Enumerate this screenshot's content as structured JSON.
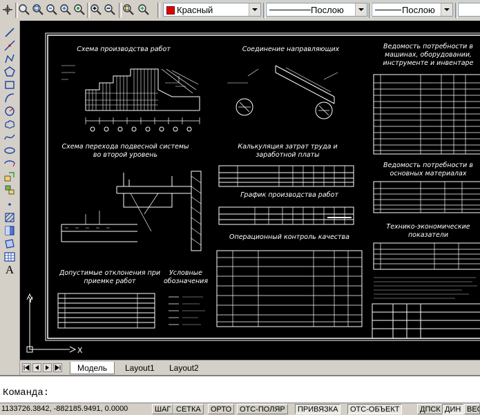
{
  "toolbar": {
    "zoom_buttons": [
      "pan-realtime-icon",
      "zoom-realtime-icon",
      "zoom-window-icon",
      "zoom-previous-icon",
      "zoom-extents-icon",
      "zoom-in-icon",
      "zoom-out-icon",
      "zoom-all-icon",
      "zoom-in-2-icon"
    ],
    "color_select": "Красный",
    "linetype_select": "Послою",
    "lineweight_select": "Послою",
    "accent_color": "#e00000"
  },
  "draw_toolbar": [
    "line-icon",
    "construction-line-icon",
    "polyline-icon",
    "polygon-icon",
    "rectangle-icon",
    "arc-icon",
    "circle-icon",
    "revcloud-icon",
    "spline-icon",
    "ellipse-icon",
    "ellipse-arc-icon",
    "insert-block-icon",
    "make-block-icon",
    "point-icon",
    "hatch-icon",
    "gradient-icon",
    "region-icon",
    "table-icon",
    "text-icon"
  ],
  "draw_text_glyph": "A",
  "drawing": {
    "titles": {
      "schema_works": "Схема производства работ",
      "guides": "Соединение направляющих",
      "statement_1": "Ведомость потребности в машинах, оборудовании, инструменте и инвентаре",
      "suspension": "Схема перехода подвесной системы во второй уровень",
      "calculation": "Калькуляция затрат труда и заработной платы",
      "materials": "Ведомость потребности в основных материалах",
      "graph": "График производства работ",
      "control": "Операционный контроль качества",
      "tep": "Технико-экономические показатели",
      "tolerances": "Допустимые отклонения при приемке работ",
      "legend": "Условные обозначения"
    },
    "ucs_x": "X",
    "ucs_y": "Y"
  },
  "tabs": {
    "model": "Модель",
    "layout1": "Layout1",
    "layout2": "Layout2"
  },
  "command": {
    "prompt": "Команда:"
  },
  "status": {
    "coords": "1133726.3842, -882185.9491, 0.0000",
    "buttons": [
      "ШАГ",
      "СЕТКА",
      "ОРТО",
      "ОТС-ПОЛЯР",
      "ПРИВЯЗКА",
      "ОТС-ОБЪЕКТ",
      "ДПСК",
      "ДИН",
      "ВЕС"
    ]
  }
}
